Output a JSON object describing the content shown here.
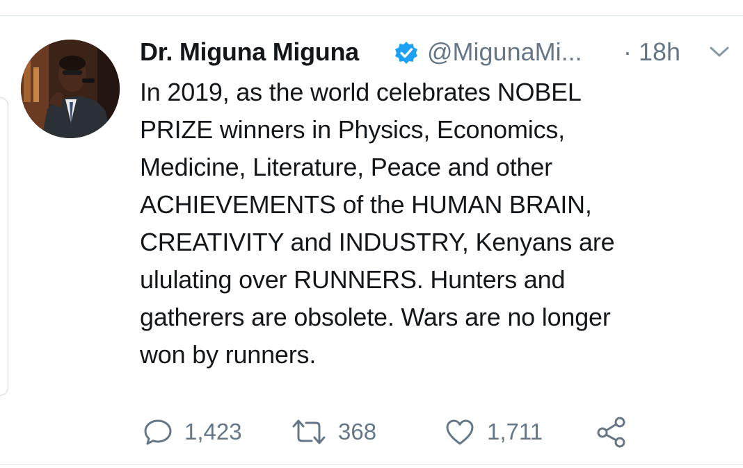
{
  "tweet": {
    "display_name": "Dr. Miguna Miguna",
    "handle": "@MigunaMi...",
    "time": "· 18h",
    "text_lines": [
      "In 2019, as the world celebrates NOBEL",
      "PRIZE winners in Physics, Economics,",
      "Medicine, Literature, Peace and other",
      "ACHIEVEMENTS of the HUMAN BRAIN,",
      "CREATIVITY and INDUSTRY, Kenyans are",
      "ululating over RUNNERS. Hunters and",
      "gatherers are obsolete. Wars are no longer",
      "won by runners."
    ],
    "verified_badge_icon": "verified-badge-icon",
    "menu_icon": "chevron-down-icon"
  },
  "actions": {
    "reply": {
      "icon": "reply-icon",
      "count": "1,423"
    },
    "retweet": {
      "icon": "retweet-icon",
      "count": "368"
    },
    "like": {
      "icon": "heart-icon",
      "count": "1,711"
    },
    "share": {
      "icon": "share-icon"
    }
  },
  "colors": {
    "text": "#14171a",
    "secondary": "#657786",
    "verified": "#1da1f2",
    "divider": "#e1e8ed"
  }
}
